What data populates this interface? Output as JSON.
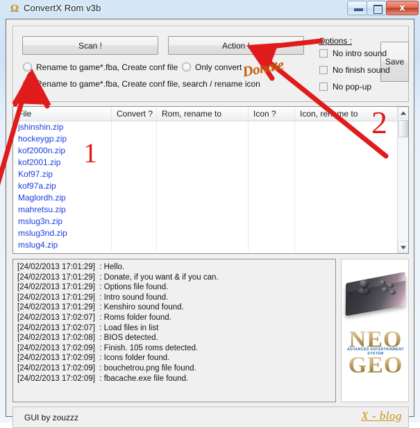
{
  "window": {
    "title": "ConvertX Rom v3b",
    "icon": "app-icon",
    "controls": {
      "minimize": "minimize",
      "maximize": "maximize",
      "close": "x"
    }
  },
  "toolbar": {
    "scan_label": "Scan !",
    "action_label": "Action !",
    "save_label": "Save"
  },
  "modes": {
    "option1": "Rename to game*.fba, Create conf file",
    "option2": "Rename to game*.fba, Create conf file, search / rename icon",
    "option3": "Only convert",
    "selected": "option2"
  },
  "options": {
    "label": "Options :",
    "items": [
      {
        "label": "No intro sound",
        "checked": false
      },
      {
        "label": "No finish sound",
        "checked": false
      },
      {
        "label": "No pop-up",
        "checked": false
      }
    ]
  },
  "list": {
    "headers": [
      "File",
      "Convert ?",
      "Rom, rename to",
      "Icon ?",
      "Icon, rename to"
    ],
    "rows": [
      {
        "file": "jshinshin.zip",
        "convert": "",
        "rom_rename": "",
        "icon": "",
        "icon_rename": ""
      },
      {
        "file": "hockeygp.zip",
        "convert": "",
        "rom_rename": "",
        "icon": "",
        "icon_rename": ""
      },
      {
        "file": "kof2000n.zip",
        "convert": "",
        "rom_rename": "",
        "icon": "",
        "icon_rename": ""
      },
      {
        "file": "kof2001.zip",
        "convert": "",
        "rom_rename": "",
        "icon": "",
        "icon_rename": ""
      },
      {
        "file": "Kof97.zip",
        "convert": "",
        "rom_rename": "",
        "icon": "",
        "icon_rename": ""
      },
      {
        "file": "kof97a.zip",
        "convert": "",
        "rom_rename": "",
        "icon": "",
        "icon_rename": ""
      },
      {
        "file": "Maglordh.zip",
        "convert": "",
        "rom_rename": "",
        "icon": "",
        "icon_rename": ""
      },
      {
        "file": "mahretsu.zip",
        "convert": "",
        "rom_rename": "",
        "icon": "",
        "icon_rename": ""
      },
      {
        "file": "mslug3n.zip",
        "convert": "",
        "rom_rename": "",
        "icon": "",
        "icon_rename": ""
      },
      {
        "file": "mslug3nd.zip",
        "convert": "",
        "rom_rename": "",
        "icon": "",
        "icon_rename": ""
      },
      {
        "file": "mslug4.zip",
        "convert": "",
        "rom_rename": "",
        "icon": "",
        "icon_rename": ""
      }
    ]
  },
  "log": {
    "lines": [
      "[24/02/2013 17:01:29]  : Hello.",
      "[24/02/2013 17:01:29]  : Donate, if you want & if you can.",
      "[24/02/2013 17:01:29]  : Options file found.",
      "[24/02/2013 17:01:29]  : Intro sound found.",
      "[24/02/2013 17:01:29]  : Kenshiro sound found.",
      "[24/02/2013 17:02:07]  : Roms folder found.",
      "[24/02/2013 17:02:07]  : Load files in list",
      "[24/02/2013 17:02:08]  : BIOS detected.",
      "[24/02/2013 17:02:09]  : Finish. 105 roms detected.",
      "[24/02/2013 17:02:09]  : Icons folder found.",
      "[24/02/2013 17:02:09]  : bouchetrou.png file found.",
      "[24/02/2013 17:02:09]  : fbacache.exe file found."
    ]
  },
  "sidepanel": {
    "logo_line1": "NEO",
    "logo_line2": "GEO",
    "tagline": "ADVANCED ENTERTAINMENT SYSTEM",
    "registered": "®"
  },
  "statusbar": {
    "credit": "GUI by zouzzz",
    "blog_link": "X - blog"
  },
  "annotations": {
    "donate": "Donate",
    "marker_1": "1",
    "marker_2": "2",
    "arrow_color": "#e01b1b",
    "donate_color": "#c06010"
  }
}
